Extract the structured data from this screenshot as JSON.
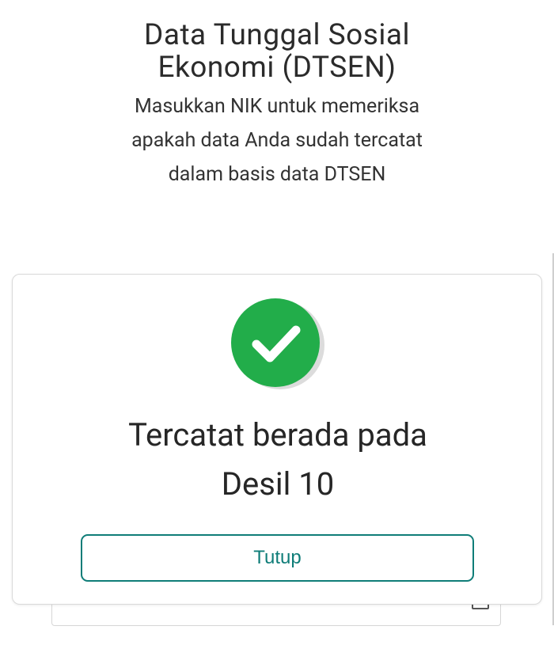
{
  "header": {
    "title_line1": "Data Tunggal Sosial",
    "title_line2": "Ekonomi (DTSEN)",
    "subtitle_line1": "Masukkan NIK untuk memeriksa",
    "subtitle_line2": "apakah data Anda sudah tercatat",
    "subtitle_line3": "dalam basis data DTSEN"
  },
  "modal": {
    "icon": "check-circle-icon",
    "status_line1": "Tercatat berada pada",
    "status_line2": "Desil 10",
    "close_label": "Tutup"
  },
  "background_form": {
    "partial_value": "",
    "icon": "calendar-icon"
  },
  "colors": {
    "success_green": "#22ad4a",
    "button_teal": "#0f7d78",
    "text_dark": "#262626"
  }
}
